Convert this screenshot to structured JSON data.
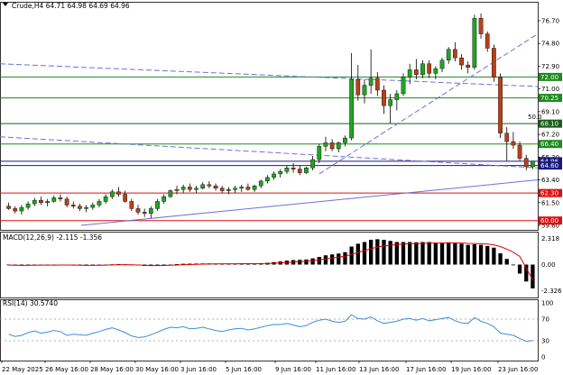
{
  "symbol_header": "Crude,H4  64.71 64.98 64.69 64.96",
  "macd_header": "MACD(12,26,9) -2.115 -1.356",
  "rsi_header": "RSI(14) 30.5740",
  "price_axis": {
    "ticks": [
      "76.70",
      "74.80",
      "72.90",
      "71.00",
      "69.10",
      "67.20",
      "65.30",
      "63.40",
      "61.50",
      "59.60"
    ],
    "tick_values": [
      76.7,
      74.8,
      72.9,
      71.0,
      69.1,
      67.2,
      65.3,
      63.4,
      61.5,
      59.6
    ]
  },
  "macd_axis": {
    "ticks": [
      "2.318",
      "0.00",
      "-2.326"
    ],
    "tick_values": [
      2.318,
      0.0,
      -2.326
    ]
  },
  "rsi_axis": {
    "ticks": [
      "100",
      "70",
      "30",
      "0"
    ],
    "tick_values": [
      100,
      70,
      30,
      0
    ]
  },
  "time_axis": [
    "22 May 2025",
    "26 May 16:00",
    "28 May 16:00",
    "30 May 16:00",
    "3 Jun 16:00",
    "5 Jun 16:00",
    "9 Jun 16:00",
    "11 Jun 16:00",
    "13 Jun 16:00",
    "17 Jun 16:00",
    "19 Jun 16:00",
    "23 Jun 16:00"
  ],
  "levels": [
    {
      "price": 72.0,
      "label": "72.00",
      "color": "#1f8a1f"
    },
    {
      "price": 70.25,
      "label": "70.25",
      "color": "#1f8a1f"
    },
    {
      "price": 68.1,
      "label": "68.10",
      "color": "#1a5e1a"
    },
    {
      "price": 66.4,
      "label": "66.40",
      "color": "#1f8a1f"
    },
    {
      "price": 64.96,
      "label": "64.96",
      "color": "#1a1a80"
    },
    {
      "price": 64.6,
      "label": "64.60",
      "color": "#1a1a80"
    },
    {
      "price": 62.3,
      "label": "62.30",
      "color": "#dd1111"
    },
    {
      "price": 60.0,
      "label": "60.00",
      "color": "#dd1111"
    }
  ],
  "fib_label": "50.0",
  "colors": {
    "bull": "#1fa51f",
    "bear": "#b8401a",
    "signal": "#dd0000",
    "rsi": "#3b8edc",
    "trend": "#6f6fd8",
    "grid": "#cccccc"
  },
  "chart_data": {
    "type": "candlestick",
    "symbol": "Crude",
    "timeframe": "H4",
    "ylim": [
      59.6,
      77.3
    ],
    "candles": [
      [
        61.2,
        61.5,
        60.9,
        61.0
      ],
      [
        61.0,
        61.2,
        60.6,
        60.8
      ],
      [
        60.8,
        61.3,
        60.5,
        61.1
      ],
      [
        61.1,
        61.6,
        60.9,
        61.4
      ],
      [
        61.4,
        61.9,
        61.2,
        61.7
      ],
      [
        61.7,
        62.0,
        61.3,
        61.5
      ],
      [
        61.5,
        61.8,
        61.2,
        61.6
      ],
      [
        61.6,
        62.1,
        61.5,
        61.9
      ],
      [
        61.9,
        62.2,
        61.6,
        61.8
      ],
      [
        61.8,
        62.0,
        61.1,
        61.3
      ],
      [
        61.3,
        61.6,
        61.0,
        61.2
      ],
      [
        61.2,
        61.4,
        60.8,
        61.0
      ],
      [
        61.0,
        61.3,
        60.7,
        61.1
      ],
      [
        61.1,
        61.5,
        60.9,
        61.3
      ],
      [
        61.3,
        61.8,
        61.1,
        61.6
      ],
      [
        61.6,
        62.2,
        61.4,
        62.0
      ],
      [
        62.0,
        62.6,
        61.8,
        62.4
      ],
      [
        62.4,
        62.8,
        62.0,
        62.2
      ],
      [
        62.2,
        62.5,
        61.5,
        61.6
      ],
      [
        61.6,
        61.8,
        60.8,
        61.0
      ],
      [
        61.0,
        61.3,
        60.5,
        60.7
      ],
      [
        60.7,
        61.0,
        60.3,
        60.6
      ],
      [
        60.6,
        61.2,
        60.2,
        61.0
      ],
      [
        61.0,
        61.8,
        60.8,
        61.6
      ],
      [
        61.6,
        62.2,
        61.4,
        62.0
      ],
      [
        62.0,
        62.6,
        61.9,
        62.5
      ],
      [
        62.5,
        62.9,
        62.2,
        62.6
      ],
      [
        62.6,
        63.0,
        62.3,
        62.8
      ],
      [
        62.8,
        63.1,
        62.4,
        62.6
      ],
      [
        62.6,
        62.9,
        62.3,
        62.7
      ],
      [
        62.7,
        63.2,
        62.6,
        63.0
      ],
      [
        63.0,
        63.3,
        62.7,
        62.9
      ],
      [
        62.9,
        63.1,
        62.5,
        62.7
      ],
      [
        62.7,
        62.9,
        62.3,
        62.5
      ],
      [
        62.5,
        62.8,
        62.2,
        62.6
      ],
      [
        62.6,
        62.9,
        62.3,
        62.7
      ],
      [
        62.7,
        63.0,
        62.4,
        62.8
      ],
      [
        62.8,
        63.1,
        62.5,
        62.6
      ],
      [
        62.6,
        63.0,
        62.4,
        62.9
      ],
      [
        62.9,
        63.4,
        62.7,
        63.3
      ],
      [
        63.3,
        63.8,
        63.1,
        63.6
      ],
      [
        63.6,
        64.1,
        63.4,
        63.9
      ],
      [
        63.9,
        64.3,
        63.6,
        64.1
      ],
      [
        64.1,
        64.6,
        63.9,
        64.4
      ],
      [
        64.4,
        64.8,
        64.0,
        64.3
      ],
      [
        64.3,
        64.6,
        63.8,
        64.0
      ],
      [
        64.0,
        64.5,
        63.9,
        64.4
      ],
      [
        64.4,
        65.4,
        64.2,
        65.1
      ],
      [
        65.1,
        66.4,
        64.8,
        66.2
      ],
      [
        66.2,
        67.0,
        65.8,
        66.5
      ],
      [
        66.5,
        66.8,
        65.8,
        66.0
      ],
      [
        66.0,
        66.6,
        65.7,
        66.5
      ],
      [
        66.5,
        67.1,
        66.2,
        66.9
      ],
      [
        66.9,
        74.0,
        66.7,
        71.8
      ],
      [
        71.8,
        73.0,
        70.0,
        70.5
      ],
      [
        70.5,
        71.8,
        69.8,
        71.3
      ],
      [
        71.3,
        74.3,
        70.6,
        71.9
      ],
      [
        71.9,
        72.4,
        70.4,
        70.9
      ],
      [
        70.9,
        71.3,
        68.9,
        69.6
      ],
      [
        69.6,
        70.6,
        68.1,
        70.1
      ],
      [
        70.1,
        70.9,
        69.2,
        70.6
      ],
      [
        70.6,
        72.3,
        70.4,
        72.0
      ],
      [
        72.0,
        73.1,
        71.4,
        72.6
      ],
      [
        72.6,
        73.5,
        71.8,
        72.2
      ],
      [
        72.2,
        73.4,
        71.9,
        73.1
      ],
      [
        73.1,
        73.4,
        71.9,
        72.3
      ],
      [
        72.3,
        72.9,
        71.8,
        72.7
      ],
      [
        72.7,
        73.6,
        72.4,
        73.4
      ],
      [
        73.4,
        74.5,
        73.1,
        74.3
      ],
      [
        74.3,
        74.9,
        73.3,
        73.6
      ],
      [
        73.6,
        73.9,
        72.6,
        73.0
      ],
      [
        73.0,
        73.3,
        72.3,
        72.8
      ],
      [
        72.8,
        77.2,
        72.6,
        76.9
      ],
      [
        76.9,
        77.3,
        75.2,
        75.6
      ],
      [
        75.6,
        75.8,
        74.1,
        74.4
      ],
      [
        74.4,
        74.7,
        71.6,
        72.0
      ],
      [
        72.0,
        72.3,
        66.9,
        67.3
      ],
      [
        67.3,
        67.8,
        65.0,
        66.6
      ],
      [
        66.6,
        67.4,
        66.0,
        66.3
      ],
      [
        66.3,
        66.6,
        65.0,
        65.2
      ],
      [
        65.2,
        65.5,
        64.2,
        64.5
      ],
      [
        64.5,
        65.0,
        64.3,
        64.96
      ]
    ],
    "macd_hist": [
      -0.05,
      -0.08,
      -0.1,
      -0.07,
      -0.04,
      -0.03,
      -0.05,
      -0.04,
      -0.02,
      -0.04,
      -0.06,
      -0.08,
      -0.09,
      -0.07,
      -0.05,
      -0.02,
      0.02,
      0.04,
      0.02,
      -0.03,
      -0.08,
      -0.12,
      -0.13,
      -0.1,
      -0.05,
      0.0,
      0.04,
      0.07,
      0.08,
      0.09,
      0.1,
      0.1,
      0.09,
      0.08,
      0.08,
      0.08,
      0.08,
      0.08,
      0.09,
      0.12,
      0.16,
      0.22,
      0.28,
      0.35,
      0.4,
      0.42,
      0.45,
      0.55,
      0.68,
      0.82,
      0.9,
      0.98,
      1.1,
      1.6,
      1.85,
      2.0,
      2.2,
      2.25,
      2.2,
      2.1,
      2.0,
      2.0,
      2.0,
      1.98,
      2.0,
      2.0,
      1.95,
      1.95,
      1.98,
      1.95,
      1.85,
      1.75,
      1.8,
      1.75,
      1.65,
      1.5,
      1.0,
      0.5,
      0.0,
      -0.8,
      -1.5,
      -2.115
    ],
    "macd_signal": [
      -0.05,
      -0.06,
      -0.07,
      -0.07,
      -0.06,
      -0.05,
      -0.05,
      -0.05,
      -0.04,
      -0.04,
      -0.05,
      -0.06,
      -0.07,
      -0.07,
      -0.06,
      -0.05,
      -0.03,
      -0.02,
      -0.01,
      -0.02,
      -0.04,
      -0.06,
      -0.08,
      -0.09,
      -0.08,
      -0.06,
      -0.04,
      -0.02,
      0.0,
      0.02,
      0.04,
      0.05,
      0.06,
      0.07,
      0.07,
      0.07,
      0.08,
      0.08,
      0.08,
      0.09,
      0.1,
      0.12,
      0.15,
      0.18,
      0.22,
      0.26,
      0.3,
      0.35,
      0.42,
      0.5,
      0.58,
      0.66,
      0.75,
      0.9,
      1.08,
      1.25,
      1.4,
      1.55,
      1.65,
      1.72,
      1.78,
      1.82,
      1.85,
      1.87,
      1.88,
      1.9,
      1.91,
      1.91,
      1.92,
      1.92,
      1.91,
      1.88,
      1.87,
      1.85,
      1.82,
      1.75,
      1.6,
      1.38,
      1.1,
      0.72,
      -0.3,
      -1.356
    ],
    "rsi": [
      42,
      38,
      40,
      45,
      48,
      44,
      46,
      49,
      47,
      40,
      42,
      41,
      40,
      44,
      47,
      51,
      54,
      50,
      45,
      39,
      36,
      37,
      41,
      46,
      51,
      55,
      54,
      56,
      52,
      53,
      55,
      52,
      49,
      47,
      50,
      52,
      53,
      50,
      52,
      55,
      58,
      60,
      60,
      62,
      59,
      56,
      58,
      64,
      68,
      70,
      66,
      64,
      66,
      78,
      71,
      70,
      74,
      67,
      62,
      64,
      66,
      70,
      71,
      68,
      71,
      67,
      69,
      71,
      73,
      67,
      63,
      62,
      73,
      66,
      62,
      56,
      44,
      42,
      40,
      34,
      29,
      30.574
    ]
  }
}
